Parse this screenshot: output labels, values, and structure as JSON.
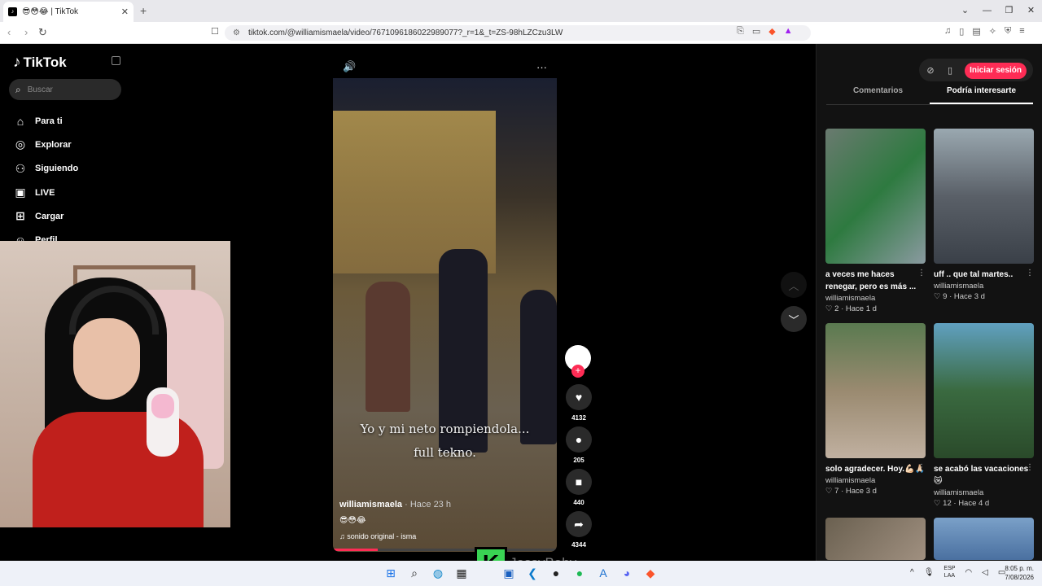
{
  "browser": {
    "tab_title": "😎😳😂 | TikTok",
    "url": "tiktok.com/@williamismaela/video/7671096186022989077?_r=1&_t=ZS-98hLZCzu3LW"
  },
  "sidebar": {
    "logo": "TikTok",
    "search_placeholder": "Buscar",
    "items": [
      {
        "label": "Para ti",
        "icon": "home-icon"
      },
      {
        "label": "Explorar",
        "icon": "compass-icon"
      },
      {
        "label": "Siguiendo",
        "icon": "following-icon"
      },
      {
        "label": "LIVE",
        "icon": "live-icon"
      },
      {
        "label": "Cargar",
        "icon": "upload-icon"
      },
      {
        "label": "Perfil",
        "icon": "profile-icon"
      }
    ]
  },
  "video": {
    "caption_line1": "Yo y mi neto rompiendola...",
    "caption_line2": "full tekno.",
    "username": "williamismaela",
    "posted": "· Hace 23 h",
    "emojis": "😎😳😂",
    "sound": "sonido original - isma",
    "progress": 0.2
  },
  "actions": {
    "likes": "4132",
    "comments": "205",
    "saves": "440",
    "shares": "4344"
  },
  "right_panel": {
    "login_label": "Iniciar sesión",
    "tab_comments": "Comentarios",
    "tab_interest": "Podría interesarte",
    "cards": [
      {
        "title": "a veces me haces renegar, pero es más ...",
        "user": "williamismaela",
        "likes": "2",
        "ago": "Hace 1 d"
      },
      {
        "title": "uff .. que tal martes..",
        "user": "williamismaela",
        "likes": "9",
        "ago": "Hace 3 d"
      },
      {
        "title": "solo agradecer. Hoy.💪🏻🙏🏻",
        "user": "williamismaela",
        "likes": "7",
        "ago": "Hace 3 d"
      },
      {
        "title": "se acabó las vacaciones 😿",
        "user": "williamismaela",
        "likes": "12",
        "ago": "Hace 4 d"
      }
    ]
  },
  "overlay": {
    "k_badge": "K",
    "streamer_name": "JessyBaby"
  },
  "taskbar": {
    "lang_top": "ESP",
    "lang_bottom": "LAA",
    "time": "8:05 p. m.",
    "date": "7/08/2026"
  }
}
